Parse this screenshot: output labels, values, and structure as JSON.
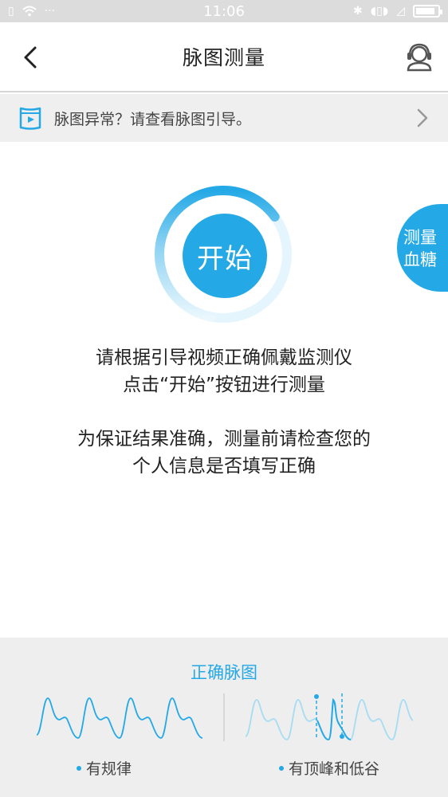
{
  "status_bar": {
    "time": "11:06",
    "more": "···",
    "battery_level": 0.9
  },
  "header": {
    "title": "脉图测量",
    "back_icon": "chevron-left-icon",
    "service_icon": "customer-service-icon"
  },
  "guide_banner": {
    "text": "脉图异常？请查看脉图引导。",
    "icon": "video-icon",
    "chevron": "chevron-right-icon"
  },
  "start": {
    "label": "开始",
    "ring_progress": 0.15
  },
  "side_button": {
    "line1": "测量",
    "line2": "血糖"
  },
  "instructions": {
    "line1": "请根据引导视频正确佩戴监测仪",
    "line2": "点击“开始”按钮进行测量",
    "line3": "为保证结果准确，测量前请检查您的",
    "line4": "个人信息是否填写正确"
  },
  "example": {
    "title": "正确脉图",
    "left_caption": "有规律",
    "right_caption": "有顶峰和低谷"
  },
  "colors": {
    "accent": "#24a9e6",
    "ring_light": "#dff3fc",
    "panel_bg": "#eeeeee",
    "banner_bg": "#efefef"
  }
}
